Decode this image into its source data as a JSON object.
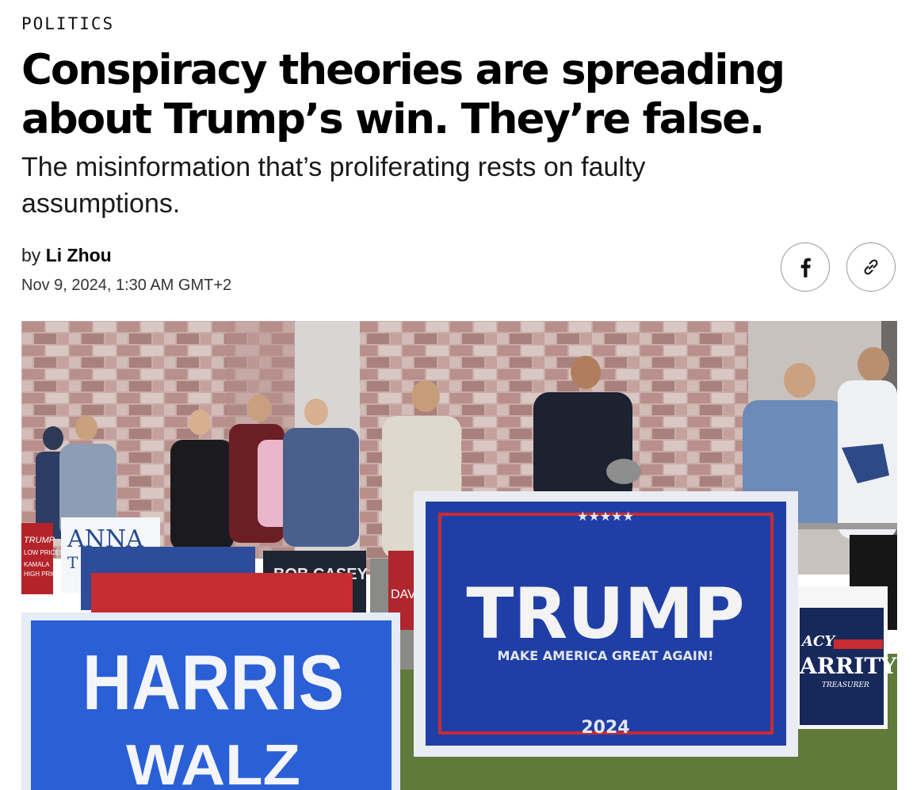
{
  "article": {
    "section": "POLITICS",
    "title": "Conspiracy theories are spreading about Trump’s win. They’re false.",
    "dek": "The misinformation that’s proliferating rests on faulty assumptions.",
    "byline_prefix": "by",
    "author": "Li Zhou",
    "date": "Nov 9, 2024, 1:30 AM GMT+2"
  },
  "share": {
    "facebook_icon": "facebook-icon",
    "link_icon": "link-icon"
  },
  "hero_image": {
    "signs": {
      "harris_line1": "HARRIS",
      "harris_line2": "WALZ",
      "trump_name": "TRUMP",
      "trump_slogan": "MAKE AMERICA GREAT AGAIN!",
      "trump_year": "2024",
      "anna": "ANNA",
      "anna_sub": "T",
      "bob_casey": "BOB CASEY",
      "dave": "DAVE",
      "stacy_top": "ACY",
      "stacy_bottom": "ARRITY",
      "stacy_role": "TREASURER",
      "trump_small_1": "TRUMP",
      "trump_small_2": "LOW PRICES",
      "trump_small_3": "KAMALA",
      "trump_small_4": "HIGH PRICES"
    },
    "colors": {
      "trump_blue": "#1f3fa6",
      "harris_blue": "#2a5fd6",
      "sign_red": "#c0272d",
      "brick_light": "#c9b1ad",
      "brick_dark": "#9d7672",
      "grass": "#5f7a3a"
    }
  }
}
